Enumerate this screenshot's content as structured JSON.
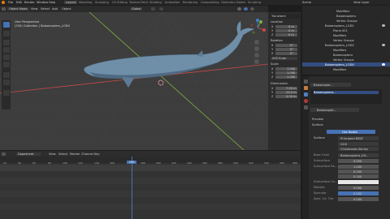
{
  "app": {
    "title": "Scene",
    "view_layer": "View Layer"
  },
  "menu": [
    "File",
    "Edit",
    "Render",
    "Window",
    "Help"
  ],
  "workspaces": [
    "Layout",
    "Modeling",
    "Sculpting",
    "UV Editing",
    "Texture Paint",
    "Shading",
    "Animation",
    "Rendering",
    "Compositing",
    "Geometry Nodes",
    "Scripting"
  ],
  "header3d": {
    "mode": "Object Mode",
    "view": "View",
    "select": "Select",
    "add": "Add",
    "object": "Object",
    "orientation": "Global"
  },
  "viewport_info": {
    "line1": "User Perspective",
    "line2": "(250) Collection | Balaenopteru_LOD0"
  },
  "npanel": {
    "transform_label": "Transform",
    "location_label": "Location",
    "location": [
      {
        "axis": "X",
        "val": "0 m"
      },
      {
        "axis": "Y",
        "val": "0 m"
      },
      {
        "axis": "Z",
        "val": "0 m"
      }
    ],
    "rotation_label": "Rotation",
    "rotation": [
      {
        "axis": "X",
        "val": "0°"
      },
      {
        "axis": "Y",
        "val": "0°"
      },
      {
        "axis": "Z",
        "val": "0°"
      }
    ],
    "mode": "XYZ Euler",
    "scale_label": "Scale",
    "scale": [
      {
        "axis": "X",
        "val": "1.000"
      },
      {
        "axis": "Y",
        "val": "1.000"
      },
      {
        "axis": "Z",
        "val": "1.000"
      }
    ],
    "dimensions_label": "Dimensions",
    "dimensions": [
      {
        "axis": "X",
        "val": "7.00 m"
      },
      {
        "axis": "Y",
        "val": "23.0 m"
      },
      {
        "axis": "Z",
        "val": "4.00 m"
      }
    ]
  },
  "outliner": {
    "rows": [
      {
        "name": "Modifiers"
      },
      {
        "name": "Balaenopteru"
      },
      {
        "name": "Vertex Groups"
      },
      {
        "name": "Balaenopteru_LOD1"
      },
      {
        "name": "Plane.001"
      },
      {
        "name": "Modifiers"
      },
      {
        "name": "Vertex Groups"
      },
      {
        "name": "Balaenopteru_LOD2"
      },
      {
        "name": "Modifiers"
      },
      {
        "name": "Balaenopteru"
      },
      {
        "name": "Vertex Groups"
      },
      {
        "name": "Balaenopteru_LOD0"
      },
      {
        "name": "Modifiers"
      }
    ]
  },
  "props": {
    "object_name": "Balaenopte...",
    "mat_name": "Balaenopte...",
    "material_slot": "Balaenoptera...",
    "preview_label": "Preview",
    "surface_label": "Surface",
    "use_nodes": "Use Nodes",
    "surface_row": {
      "label": "Surface",
      "value": "Principled BSDF"
    },
    "ggx": "GGX",
    "christensen": "Christensen-Burley",
    "rows": [
      {
        "label": "Base Color",
        "value": "Balaenoptera_Dif..."
      },
      {
        "label": "Subsurface",
        "value": "0.000"
      },
      {
        "label": "Subsurface Ra...",
        "value": "1.000"
      },
      {
        "label": "",
        "value": "0.200"
      },
      {
        "label": "",
        "value": "0.100"
      },
      {
        "label": "Subsurface Co...",
        "value": ""
      },
      {
        "label": "Metallic",
        "value": "0.000"
      },
      {
        "label": "Specular",
        "value": "0.500"
      },
      {
        "label": "Spec. Lit. Tint",
        "value": "0.000"
      }
    ]
  },
  "dopesheet": {
    "mode": "Dopesheet",
    "menus": [
      "View",
      "Select",
      "Marker",
      "Channel",
      "Key"
    ],
    "current_frame": "250"
  },
  "timeline_ticks": [
    "20",
    "40",
    "60",
    "80",
    "100",
    "120",
    "140",
    "160",
    "180",
    "200",
    "220",
    "240",
    "260",
    "280",
    "300",
    "320",
    "340",
    "360",
    "380"
  ],
  "colors": {
    "accent": "#4772b3",
    "x_axis": "#c94a4a",
    "y_axis": "#7fb03c",
    "z_axis": "#3f7fd6"
  }
}
